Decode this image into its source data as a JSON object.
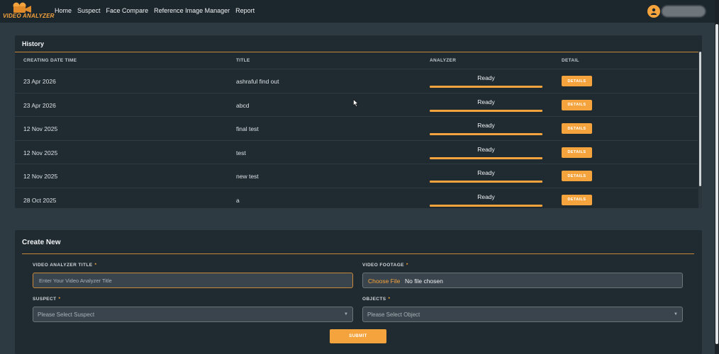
{
  "app": {
    "logo_text": "VIDEO ANALYZER",
    "accent_color": "#f5a33c"
  },
  "nav": {
    "items": [
      {
        "label": "Home"
      },
      {
        "label": "Suspect"
      },
      {
        "label": "Face Compare"
      },
      {
        "label": "Reference Image Manager"
      },
      {
        "label": "Report"
      }
    ]
  },
  "user": {
    "icon": "user-icon"
  },
  "history": {
    "title": "History",
    "columns": {
      "date": "CREATING DATE TIME",
      "title": "TITLE",
      "analyzer": "ANALYZER",
      "detail": "DETAIL"
    },
    "rows": [
      {
        "date": "23 Apr 2026",
        "title": "ashraful find out",
        "status": "Ready",
        "action": "DETAILS"
      },
      {
        "date": "23 Apr 2026",
        "title": "abcd",
        "status": "Ready",
        "action": "DETAILS"
      },
      {
        "date": "12 Nov 2025",
        "title": "final test",
        "status": "Ready",
        "action": "DETAILS"
      },
      {
        "date": "12 Nov 2025",
        "title": "test",
        "status": "Ready",
        "action": "DETAILS"
      },
      {
        "date": "12 Nov 2025",
        "title": "new test",
        "status": "Ready",
        "action": "DETAILS"
      },
      {
        "date": "28 Oct 2025",
        "title": "a",
        "status": "Ready",
        "action": "DETAILS"
      }
    ]
  },
  "create": {
    "title": "Create New",
    "title_field": {
      "label": "VIDEO ANALYZER TITLE",
      "required": "*",
      "placeholder": "Enter Your Video Analyzer Title",
      "value": ""
    },
    "footage_field": {
      "label": "VIDEO FOOTAGE",
      "required": "*",
      "button": "Choose File",
      "status": "No file chosen"
    },
    "suspect_field": {
      "label": "SUSPECT",
      "required": "*",
      "placeholder": "Please Select Suspect"
    },
    "objects_field": {
      "label": "OBJECTS",
      "required": "*",
      "placeholder": "Please Select Object"
    },
    "submit": "SUBMIT"
  }
}
